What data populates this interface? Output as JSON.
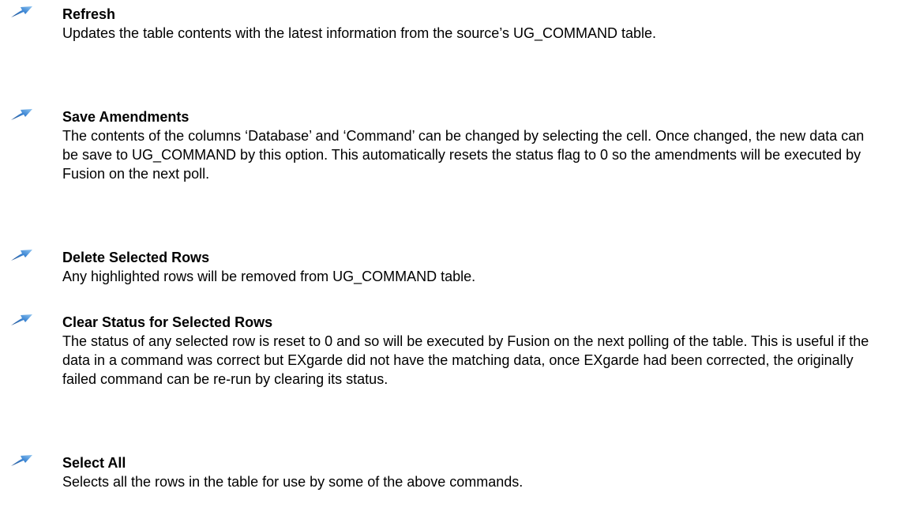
{
  "colors": {
    "text": "#000000",
    "background": "#ffffff",
    "bullet_dark": "#1a4a8a",
    "bullet_light": "#8fc4f0"
  },
  "bullet_icon": "blue-arrow-bullet-icon",
  "items": [
    {
      "title": "Refresh",
      "description": "Updates the table contents with the latest information from the source’s UG_COMMAND table."
    },
    {
      "title": "Save Amendments",
      "description": "The contents of the columns ‘Database’ and ‘Command’ can be changed by selecting the cell. Once changed, the new data can be save to UG_COMMAND by this option. This automatically resets the status flag to 0 so the amendments will be executed by Fusion on the next poll."
    },
    {
      "title": "Delete Selected Rows",
      "description": "Any highlighted rows will be removed from UG_COMMAND table."
    },
    {
      "title": "Clear Status for Selected Rows",
      "description": "The status of any selected row is reset to 0 and so will be executed by Fusion on the next polling of the table. This is useful if the data in a command was correct but EXgarde did not have the matching data, once EXgarde had been corrected, the originally failed command can be re-run by clearing its status."
    },
    {
      "title": "Select All",
      "description": "Selects all the rows in the table for use by some of the above commands."
    }
  ]
}
